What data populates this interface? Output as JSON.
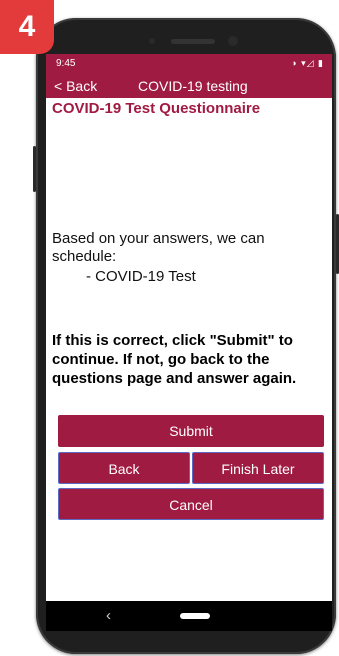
{
  "badge": "4",
  "status_bar": {
    "time": "9:45",
    "icons": "◑ ▾◿ ▮"
  },
  "app_bar": {
    "back_label": "< Back",
    "title": "COVID-19 testing"
  },
  "questionnaire": {
    "title": "COVID-19 Test Questionnaire",
    "intro": "Based on your answers, we can schedule:",
    "items": [
      "-  COVID-19 Test"
    ],
    "instruction": "If this is correct, click \"Submit\" to continue. If not, go back to the questions page and answer again."
  },
  "buttons": {
    "submit": "Submit",
    "back": "Back",
    "finish_later": "Finish Later",
    "cancel": "Cancel"
  },
  "nav": {
    "back_glyph": "‹"
  },
  "colors": {
    "accent": "#a01b42",
    "badge": "#e33b3b",
    "button_border": "#5a6bc4"
  }
}
